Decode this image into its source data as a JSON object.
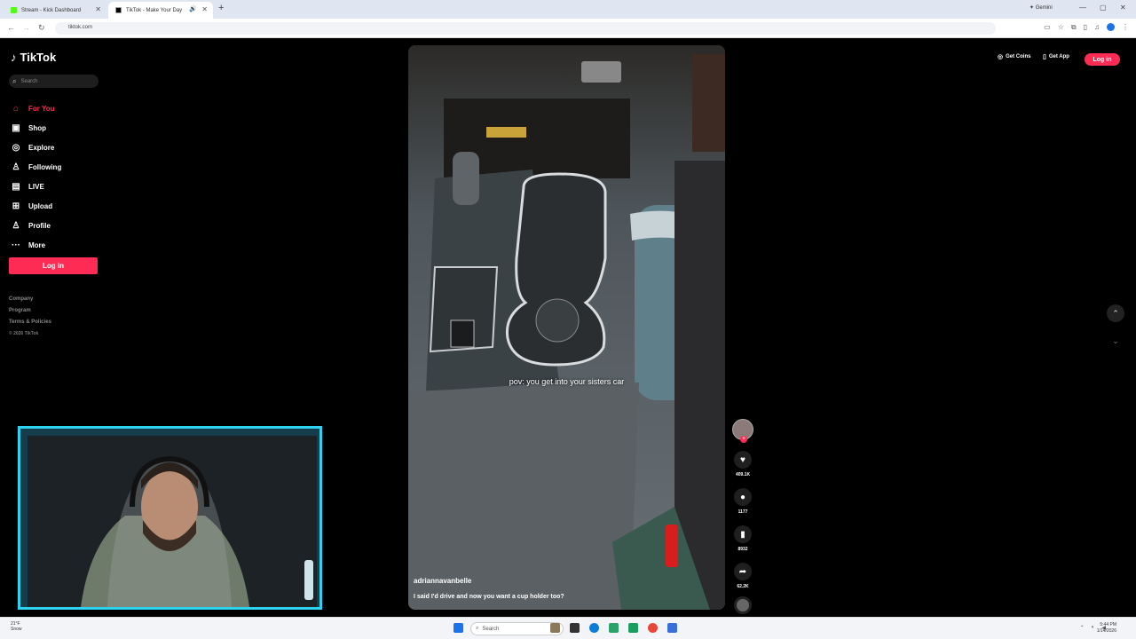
{
  "browser": {
    "tabs": [
      {
        "title": "Stream - Kick Dashboard",
        "active": false,
        "favicon_color": "#53fc18"
      },
      {
        "title": "TikTok - Make Your Day",
        "active": true,
        "favicon_color": "#000000"
      }
    ],
    "new_tab_symbol": "+",
    "gemini_label": "Gemini",
    "url": "tiktok.com"
  },
  "sidebar": {
    "logo": "TikTok",
    "search_placeholder": "Search",
    "nav": [
      {
        "label": "For You",
        "icon": "home-icon",
        "active": true
      },
      {
        "label": "Shop",
        "icon": "shop-icon",
        "active": false
      },
      {
        "label": "Explore",
        "icon": "compass-icon",
        "active": false
      },
      {
        "label": "Following",
        "icon": "following-icon",
        "active": false
      },
      {
        "label": "LIVE",
        "icon": "live-icon",
        "active": false
      },
      {
        "label": "Upload",
        "icon": "upload-icon",
        "active": false
      },
      {
        "label": "Profile",
        "icon": "profile-icon",
        "active": false
      },
      {
        "label": "More",
        "icon": "more-icon",
        "active": false
      }
    ],
    "login_label": "Log in",
    "footer": {
      "links": [
        "Company",
        "Program",
        "Terms & Policies"
      ],
      "copyright": "© 2026 TikTok"
    }
  },
  "header": {
    "get_coins": "Get Coins",
    "get_app": "Get App",
    "login": "Log in"
  },
  "video": {
    "overlay_caption": "pov: you get into your sisters car",
    "username": "adriannavanbelle",
    "description": "I said I'd drive and now you want a cup holder too?"
  },
  "actions": {
    "likes": "409.1K",
    "comments": "1177",
    "saves": "8932",
    "shares": "62.2K"
  },
  "taskbar": {
    "weather_temp": "21°F",
    "weather_desc": "Snow",
    "search_placeholder": "Search",
    "time": "5:44 PM",
    "date": "1/14/2026"
  },
  "colors": {
    "accent": "#fe2c55",
    "webcam_border": "#2dd2f0"
  }
}
